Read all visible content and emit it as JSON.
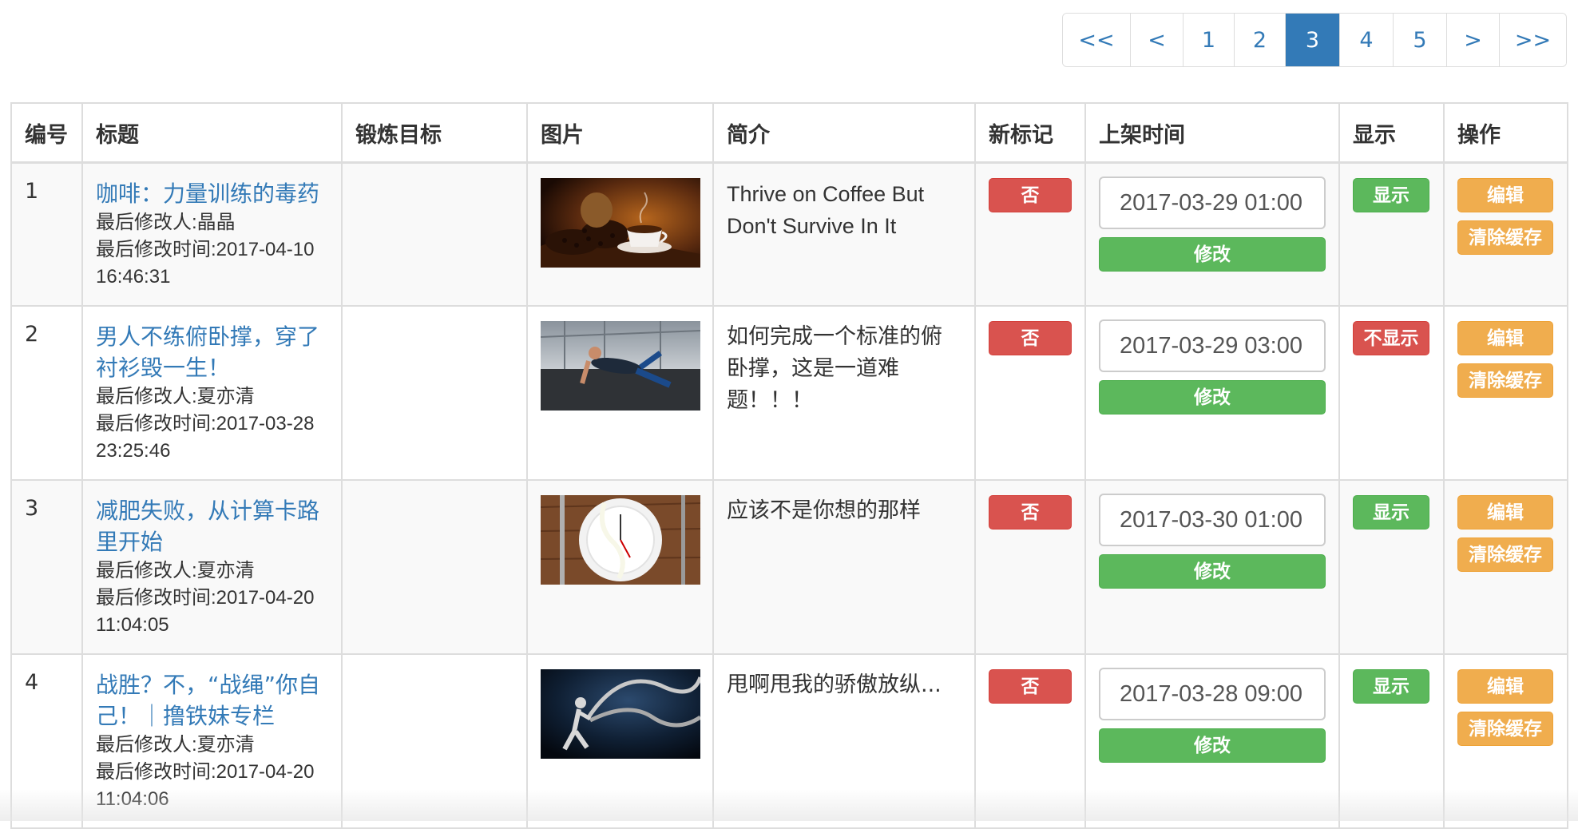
{
  "pagination": {
    "items": [
      "<<",
      "<",
      "1",
      "2",
      "3",
      "4",
      "5",
      ">",
      ">>"
    ],
    "active": "3"
  },
  "table": {
    "headers": [
      "编号",
      "标题",
      "锻炼目标",
      "图片",
      "简介",
      "新标记",
      "上架时间",
      "显示",
      "操作"
    ],
    "rows": [
      {
        "id": "1",
        "title": "咖啡：力量训练的毒药",
        "modifier": "最后修改人:晶晶",
        "modified_time": "最后修改时间:2017-04-10 16:46:31",
        "goal": "",
        "image": "coffee-beans-cup-image",
        "intro": "Thrive on Coffee But Don't Survive In It",
        "new_flag": "否",
        "publish_time": "2017-03-29 01:00",
        "modify_label": "修改",
        "display": "显示",
        "edit_label": "编辑",
        "clear_cache_label": "清除缓存"
      },
      {
        "id": "2",
        "title": "男人不练俯卧撑，穿了衬衫毁一生！",
        "modifier": "最后修改人:夏亦清",
        "modified_time": "最后修改时间:2017-03-28 23:25:46",
        "goal": "",
        "image": "man-pushup-gym-image",
        "intro": "如何完成一个标准的俯卧撑，这是一道难题！！！",
        "new_flag": "否",
        "publish_time": "2017-03-29 03:00",
        "modify_label": "修改",
        "display": "不显示",
        "edit_label": "编辑",
        "clear_cache_label": "清除缓存"
      },
      {
        "id": "3",
        "title": "减肥失败，从计算卡路里开始",
        "modifier": "最后修改人:夏亦清",
        "modified_time": "最后修改时间:2017-04-20 11:04:05",
        "goal": "",
        "image": "plate-clock-measuring-tape-image",
        "intro": "应该不是你想的那样",
        "new_flag": "否",
        "publish_time": "2017-03-30 01:00",
        "modify_label": "修改",
        "display": "显示",
        "edit_label": "编辑",
        "clear_cache_label": "清除缓存"
      },
      {
        "id": "4",
        "title": "战胜？不，“战绳”你自己！｜撸铁妹专栏",
        "modifier": "最后修改人:夏亦清",
        "modified_time": "最后修改时间:2017-04-20 11:04:06",
        "goal": "",
        "image": "battle-ropes-athlete-image",
        "intro": "甩啊甩我的骄傲放纵...",
        "new_flag": "否",
        "publish_time": "2017-03-28 09:00",
        "modify_label": "修改",
        "display": "显示",
        "edit_label": "编辑",
        "clear_cache_label": "清除缓存"
      }
    ]
  },
  "colors": {
    "link": "#337ab7",
    "danger": "#d9534f",
    "success": "#5cb85c",
    "warning": "#f0ad4e"
  }
}
